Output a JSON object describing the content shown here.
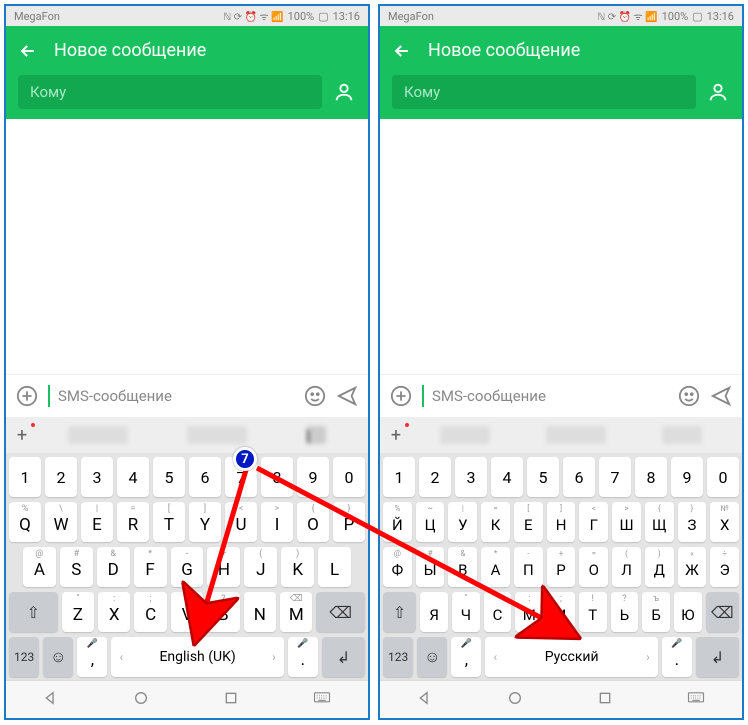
{
  "status": {
    "carrier": "MegaFon",
    "icons": "ℕ 🕓 ᯤ 📶 100%",
    "time": "13:16",
    "battery": "100%"
  },
  "header": {
    "title": "Новое сообщение"
  },
  "recipient": {
    "placeholder": "Кому"
  },
  "compose": {
    "placeholder": "SMS-сообщение"
  },
  "badge": {
    "number": "7"
  },
  "keyboard_en": {
    "row_num": [
      "1",
      "2",
      "3",
      "4",
      "5",
      "6",
      "7",
      "8",
      "9",
      "0"
    ],
    "row1_top": [
      "%",
      "\\",
      "|",
      "=",
      "[",
      "]",
      "<",
      ">",
      "{",
      "}"
    ],
    "row1": [
      "Q",
      "W",
      "E",
      "R",
      "T",
      "Y",
      "U",
      "I",
      "O",
      "P"
    ],
    "row2_top": [
      "@",
      "#",
      "&",
      "*",
      "-",
      "+",
      "(",
      ")"
    ],
    "row2": [
      "A",
      "S",
      "D",
      "F",
      "G",
      "H",
      "J",
      "K",
      "L"
    ],
    "row3_top": [
      "\"",
      ":",
      ";",
      "!",
      "?",
      "",
      "⌫"
    ],
    "row3": [
      "Z",
      "X",
      "C",
      "V",
      "B",
      "N",
      "M"
    ],
    "spacebar": "English (UK)",
    "key_123": "123",
    "comma": ",",
    "period": "."
  },
  "keyboard_ru": {
    "row_num": [
      "1",
      "2",
      "3",
      "4",
      "5",
      "6",
      "7",
      "8",
      "9",
      "0"
    ],
    "row1_top": [
      "%",
      "~",
      "|",
      "=",
      "[",
      "]",
      "<",
      ">",
      "{",
      "}",
      "№"
    ],
    "row1": [
      "Й",
      "Ц",
      "У",
      "К",
      "Е",
      "Н",
      "Г",
      "Ш",
      "Щ",
      "З",
      "Х"
    ],
    "row2_top": [
      "@",
      "#",
      "&",
      "*",
      "-",
      "+",
      "=",
      "(",
      ")",
      "«",
      "÷"
    ],
    "row2": [
      "Ф",
      "Ы",
      "В",
      "А",
      "П",
      "Р",
      "О",
      "Л",
      "Д",
      "Ж",
      "Э"
    ],
    "row3_top": [
      "",
      "\"",
      "'",
      ":",
      ";",
      "!",
      "?",
      "ъ",
      ""
    ],
    "row3": [
      "Я",
      "Ч",
      "С",
      "М",
      "И",
      "Т",
      "Ь",
      "Б",
      "Ю"
    ],
    "spacebar": "Русский",
    "key_123": "123",
    "comma": ",",
    "period": "."
  },
  "nav": {
    "back": "◁",
    "home": "○",
    "recent": "▢",
    "kbd": "⌨"
  }
}
